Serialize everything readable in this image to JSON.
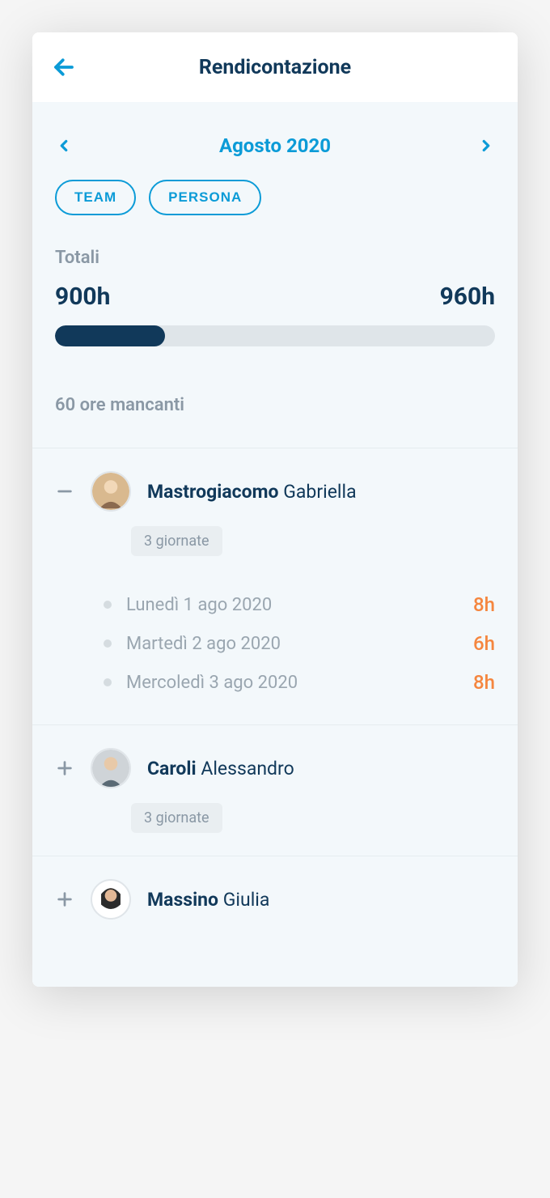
{
  "header": {
    "title": "Rendicontazione"
  },
  "month": {
    "label": "Agosto 2020"
  },
  "filters": {
    "team": "TEAM",
    "persona": "PERSONA"
  },
  "totals": {
    "label": "Totali",
    "current": "900h",
    "target": "960h"
  },
  "missing": {
    "label": "60 ore mancanti"
  },
  "people": [
    {
      "surname": "Mastrogiacomo",
      "firstname": "Gabriella",
      "expanded": true,
      "days_label": "3 giornate",
      "days": [
        {
          "label": "Lunedì 1 ago 2020",
          "hours": "8h"
        },
        {
          "label": "Martedì 2 ago 2020",
          "hours": "6h"
        },
        {
          "label": "Mercoledì 3 ago 2020",
          "hours": "8h"
        }
      ]
    },
    {
      "surname": "Caroli",
      "firstname": "Alessandro",
      "expanded": false,
      "days_label": "3 giornate"
    },
    {
      "surname": "Massino",
      "firstname": "Giulia",
      "expanded": false
    }
  ]
}
